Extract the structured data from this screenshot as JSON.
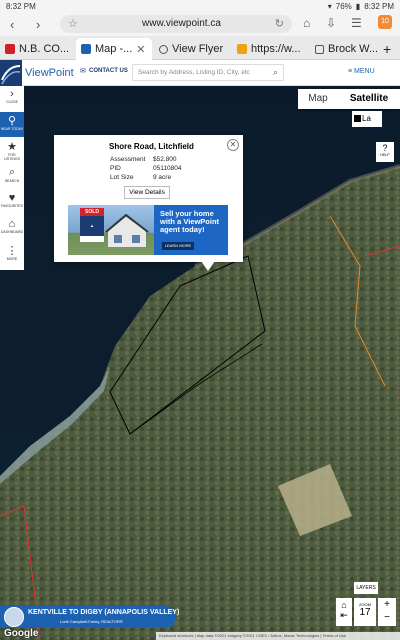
{
  "status_bar": {
    "time_left": "8:32 PM",
    "battery": "76%",
    "time_right": "8:32 PM"
  },
  "browser": {
    "url": "www.viewpoint.ca",
    "tabs": [
      {
        "label": "N.B. CO..."
      },
      {
        "label": "Map -..."
      },
      {
        "label": "View Flyer"
      },
      {
        "label": "https://w..."
      },
      {
        "label": "Brock W..."
      }
    ],
    "extension_badge": "10",
    "new_tab_symbol": "+"
  },
  "site_header": {
    "logo_text": "ViewPoint",
    "contact_label": "CONTACT US",
    "search_placeholder": "Search by Address, Listing ID, City, etc",
    "menu_label": "MENU"
  },
  "sidebar": {
    "items": [
      {
        "label": "CLOSE",
        "icon": "chevron-right-icon"
      },
      {
        "label": "NEAR TODAY",
        "icon": "location-pin-icon"
      },
      {
        "label": "FOR LISTINGS",
        "icon": "star-icon"
      },
      {
        "label": "SEARCH",
        "icon": "search-icon"
      },
      {
        "label": "FAVOURITES",
        "icon": "heart-icon"
      },
      {
        "label": "DASHBOARD",
        "icon": "home-icon"
      },
      {
        "label": "MORE",
        "icon": "more-icon"
      }
    ]
  },
  "map_controls": {
    "map_label": "Map",
    "satellite_label": "Satellite",
    "labels_checkbox": "La",
    "help_label": "HELP",
    "layers_label": "LAYERS",
    "zoom_label": "ZOOM",
    "zoom_level": "17"
  },
  "popup": {
    "title": "Shore Road, Litchfield",
    "rows": [
      {
        "key": "Assessment",
        "value": "$52,800"
      },
      {
        "key": "PID",
        "value": "05110804"
      },
      {
        "key": "Lot Size",
        "value": "9 acre"
      }
    ],
    "details_button": "View Details",
    "ad": {
      "sold_sign": "SOLD",
      "headline": "Sell your home with a ViewPoint agent today!",
      "cta": "LEARN MORE"
    }
  },
  "banner": {
    "title": "KENTVILLE TO DIGBY (ANNAPOLIS VALLEY)",
    "subtitle": "Lorie Campbell-Farley, REALTOR®"
  },
  "footer": {
    "google": "Google",
    "attribution": "Keyboard shortcuts  |  Map data ©2021  Imagery ©2021 CNES / Airbus, Maxar Technologies  |  Terms of Use"
  }
}
